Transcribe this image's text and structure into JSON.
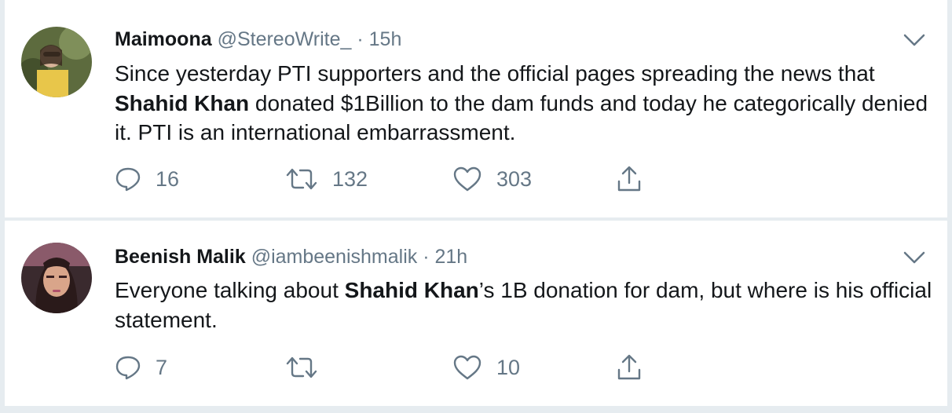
{
  "tweets": [
    {
      "name": "Maimoona",
      "handle": "@StereoWrite_",
      "separator": "·",
      "time": "15h",
      "text_parts": [
        "Since yesterday PTI supporters and the official pages spreading the news that ",
        "Shahid Khan",
        " donated $1Billion to the dam funds and today he categorically denied it. PTI is an international embarrassment."
      ],
      "replies": "16",
      "retweets": "132",
      "likes": "303"
    },
    {
      "name": "Beenish Malik",
      "handle": "@iambeenishmalik",
      "separator": "·",
      "time": "21h",
      "text_parts": [
        "Everyone talking about ",
        "Shahid Khan",
        "’s 1B donation for dam, but where is his official statement."
      ],
      "replies": "7",
      "retweets": "",
      "likes": "10"
    }
  ],
  "colors": {
    "text": "#14171a",
    "secondary": "#657786",
    "background": "#e6ecf0",
    "card": "#ffffff"
  },
  "icons": [
    "reply-icon",
    "retweet-icon",
    "like-icon",
    "share-icon",
    "chevron-down-icon"
  ]
}
